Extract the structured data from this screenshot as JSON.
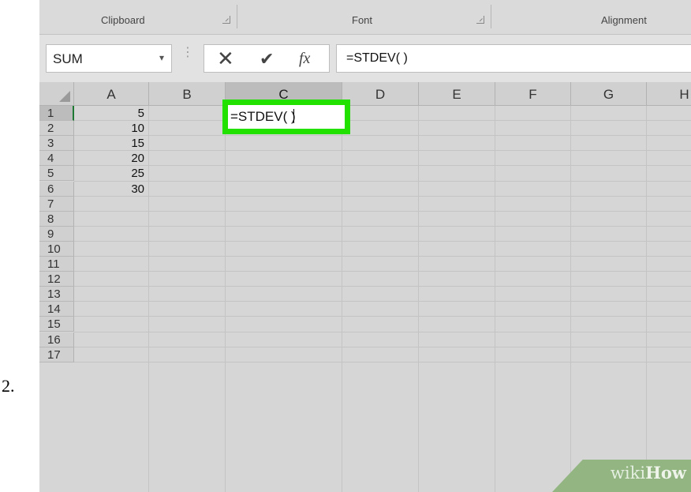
{
  "step_number": "2.",
  "ribbon": {
    "groups": [
      {
        "label": "Clipboard",
        "has_launcher": true
      },
      {
        "label": "Font",
        "has_launcher": true
      },
      {
        "label": "Alignment",
        "has_launcher": false
      }
    ]
  },
  "formula_bar": {
    "name_box": "SUM",
    "name_box_icon": "chevron-down-icon",
    "grip_icon": "vertical-dots-icon",
    "cancel_icon": "close-x-icon",
    "cancel_glyph": "✕",
    "enter_icon": "checkmark-icon",
    "enter_glyph": "✔",
    "function_label": "fx",
    "formula": "=STDEV( )"
  },
  "grid": {
    "columns": [
      "A",
      "B",
      "C",
      "D",
      "E",
      "F",
      "G",
      "H"
    ],
    "rows": [
      "1",
      "2",
      "3",
      "4",
      "5",
      "6",
      "7",
      "8",
      "9",
      "10",
      "11",
      "12",
      "13",
      "14",
      "15",
      "16",
      "17"
    ],
    "column_a_values": [
      "5",
      "10",
      "15",
      "20",
      "25",
      "30"
    ],
    "active_cell": {
      "ref": "C1",
      "text": "=STDEV( )"
    },
    "highlight_color": "#22e000"
  },
  "watermark": {
    "prefix": "wiki",
    "suffix": "How"
  }
}
